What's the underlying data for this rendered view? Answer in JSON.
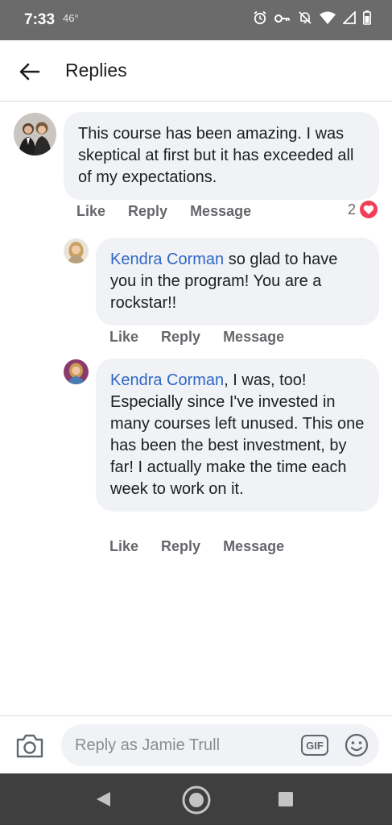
{
  "status_bar": {
    "time": "7:33",
    "temperature": "46°",
    "icons": [
      "alarm-icon",
      "key-icon",
      "mute-icon",
      "wifi-icon",
      "signal-icon",
      "battery-icon"
    ]
  },
  "header": {
    "back_icon": "arrow-left-icon",
    "title": "Replies"
  },
  "comments": [
    {
      "text": "This course has been amazing. I was skeptical at first but it has exceeded all of my expectations.",
      "actions": {
        "like": "Like",
        "reply": "Reply",
        "message": "Message"
      },
      "reaction_count": "2",
      "reaction_icon": "heart-icon"
    },
    {
      "mention": "Kendra Corman",
      "text": " so glad to have you in the program!  You are a rockstar!!",
      "actions": {
        "like": "Like",
        "reply": "Reply",
        "message": "Message"
      }
    },
    {
      "mention": "Kendra Corman",
      "text": ", I was, too! Especially since I've invested in many courses left unused. This one has been the best investment, by far! I actually make the time each week to work on it.",
      "actions": {
        "like": "Like",
        "reply": "Reply",
        "message": "Message"
      }
    }
  ],
  "composer": {
    "placeholder": "Reply as Jamie Trull",
    "gif_label": "GIF",
    "camera_icon": "camera-icon",
    "emoji_icon": "smiley-icon"
  },
  "colors": {
    "mention": "#2f66c8",
    "bubble": "#f0f2f5",
    "heart": "#f33e58",
    "status_bar": "#6b6b6b",
    "nav_bar": "#3f3f3f"
  }
}
